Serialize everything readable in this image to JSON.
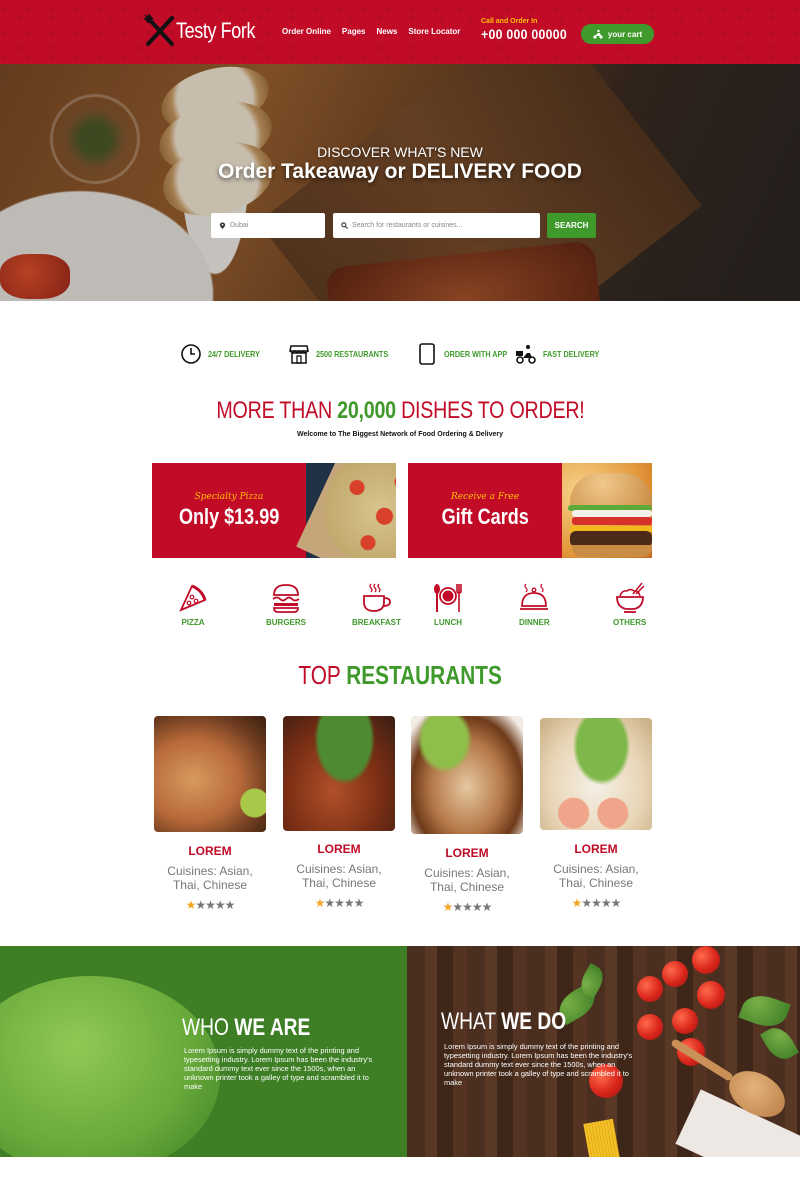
{
  "header": {
    "brand": "Testy Fork",
    "nav": [
      "Order Online",
      "Pages",
      "News",
      "Store Locator"
    ],
    "call_label": "Call and Order In",
    "phone": "+00 000 00000",
    "cart_label": "your cart"
  },
  "hero": {
    "subtitle": "DISCOVER WHAT'S NEW",
    "title_part1": "Order Takeaway or ",
    "title_part2": "DELIVERY FOOD",
    "location_value": "Dubai",
    "search_placeholder": "Search for restaurants or cuisines...",
    "search_button": "SEARCH"
  },
  "features": [
    {
      "icon": "clock-icon",
      "label": "24/7 DELIVERY"
    },
    {
      "icon": "store-icon",
      "label": "2500 RESTAURANTS"
    },
    {
      "icon": "tablet-icon",
      "label": "ORDER WITH APP"
    },
    {
      "icon": "delivery-scooter-icon",
      "label": "FAST DELIVERY"
    }
  ],
  "headline": {
    "part1": "MORE THAN ",
    "highlight": "20,000",
    "part2": " DISHES TO ORDER!",
    "welcome": "Welcome to The Biggest Network of Food Ordering & Delivery"
  },
  "promos": [
    {
      "script": "Specialty Pizza",
      "big": "Only $13.99"
    },
    {
      "script": "Receive a Free",
      "big": "Gift Cards"
    }
  ],
  "categories": [
    {
      "icon": "pizza-icon",
      "label": "PIZZA"
    },
    {
      "icon": "burger-icon",
      "label": "BURGERS"
    },
    {
      "icon": "coffee-cup-icon",
      "label": "BREAKFAST"
    },
    {
      "icon": "plate-cutlery-icon",
      "label": "LUNCH"
    },
    {
      "icon": "cloche-icon",
      "label": "DINNER"
    },
    {
      "icon": "rice-bowl-icon",
      "label": "OTHERS"
    }
  ],
  "top_restaurants": {
    "title_part1": "TOP ",
    "title_part2": "RESTAURANTS",
    "items": [
      {
        "name": "LOREM",
        "cuisine_line1": "Cuisines: Asian,",
        "cuisine_line2": "Thai, Chinese",
        "rating": 1,
        "max_rating": 5
      },
      {
        "name": "LOREM",
        "cuisine_line1": "Cuisines: Asian,",
        "cuisine_line2": "Thai, Chinese",
        "rating": 1,
        "max_rating": 5
      },
      {
        "name": "LOREM",
        "cuisine_line1": "Cuisines: Asian,",
        "cuisine_line2": "Thai, Chinese",
        "rating": 1,
        "max_rating": 5
      },
      {
        "name": "LOREM",
        "cuisine_line1": "Cuisines: Asian,",
        "cuisine_line2": "Thai, Chinese",
        "rating": 1,
        "max_rating": 5
      }
    ]
  },
  "who_we_are": {
    "title_light": "WHO ",
    "title_bold": "WE ARE",
    "body": "Lorem Ipsum is simply dummy text of the printing and typesetting industry. Lorem Ipsum has been the industry's standard dummy text ever since the 1500s, when an unknown printer took a galley of type and scrambled it to make"
  },
  "what_we_do": {
    "title_light": "WHAT ",
    "title_bold": "WE DO",
    "body": "Lorem Ipsum is simply dummy text of the printing and typesetting industry. Lorem Ipsum has been the industry's standard dummy text ever since the 1500s, when an unknown printer took a galley of type and scrambled it to make"
  },
  "colors": {
    "brand_red": "#c10b27",
    "brand_green": "#3f9a2b",
    "accent_yellow": "#ffc107",
    "star_active": "#f5a623"
  }
}
